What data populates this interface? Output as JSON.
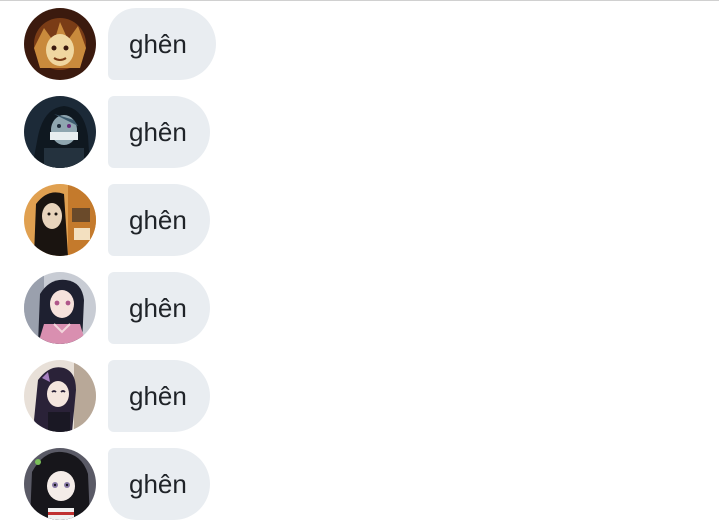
{
  "messages": [
    {
      "text": "ghên",
      "avatar_icon": "anime-avatar-rengoku-icon",
      "avatar_colors": [
        "#3b1a0e",
        "#c98a3c",
        "#f0d7a0"
      ]
    },
    {
      "text": "ghên",
      "avatar_icon": "anime-avatar-obanai-icon",
      "avatar_colors": [
        "#1c2a38",
        "#3f5d70",
        "#8fa6b0"
      ]
    },
    {
      "text": "ghên",
      "avatar_icon": "anime-avatar-himejima-icon",
      "avatar_colors": [
        "#1a1410",
        "#6a4a2a",
        "#e0a050"
      ]
    },
    {
      "text": "ghên",
      "avatar_icon": "anime-avatar-nezuko-icon",
      "avatar_colors": [
        "#1e2030",
        "#d98fb0",
        "#f3d6dc"
      ]
    },
    {
      "text": "ghên",
      "avatar_icon": "anime-avatar-shinobu-icon",
      "avatar_colors": [
        "#2a2238",
        "#a57fbf",
        "#e8e0d8"
      ]
    },
    {
      "text": "ghên",
      "avatar_icon": "anime-avatar-kanao-icon",
      "avatar_colors": [
        "#17161b",
        "#5a5a66",
        "#f4ece8"
      ]
    }
  ]
}
